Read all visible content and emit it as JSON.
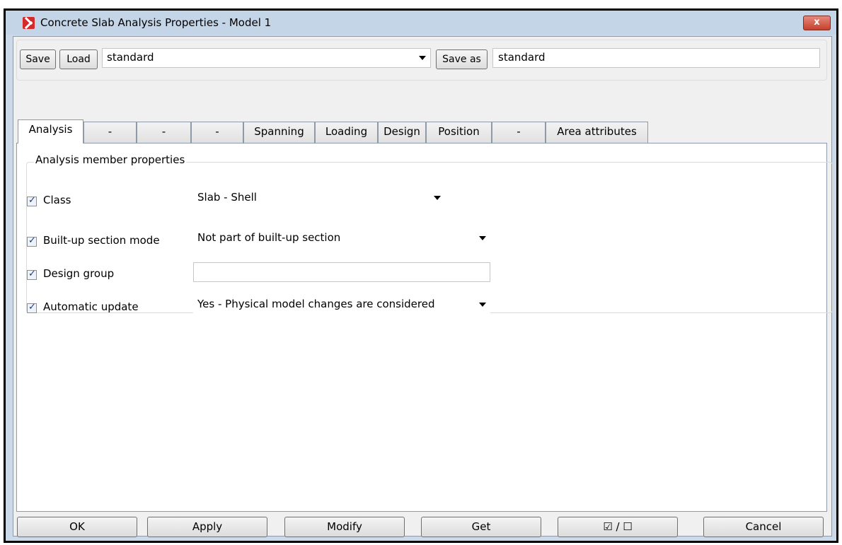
{
  "window": {
    "title": "Concrete Slab Analysis Properties - Model 1",
    "close_label": "x"
  },
  "toolbar": {
    "save_label": "Save",
    "load_label": "Load",
    "preset_value": "standard",
    "save_as_label": "Save as",
    "save_as_value": "standard"
  },
  "tabs": [
    {
      "label": "Analysis",
      "active": true
    },
    {
      "label": "-"
    },
    {
      "label": "-"
    },
    {
      "label": "-"
    },
    {
      "label": "Spanning"
    },
    {
      "label": "Loading"
    },
    {
      "label": "Design"
    },
    {
      "label": "Position"
    },
    {
      "label": "-"
    },
    {
      "label": "Area attributes"
    }
  ],
  "group": {
    "title": "Analysis member properties",
    "rows": [
      {
        "label": "Class",
        "value": "Slab - Shell",
        "checked": true
      },
      {
        "label": "Built-up section mode",
        "value": "Not part of built-up section",
        "checked": true
      },
      {
        "label": "Design group",
        "value": "",
        "checked": true
      },
      {
        "label": "Automatic update",
        "value": "Yes - Physical model changes are considered",
        "checked": true
      }
    ]
  },
  "footer": {
    "ok": "OK",
    "apply": "Apply",
    "modify": "Modify",
    "get": "Get",
    "toggle": "☑ / ☐",
    "cancel": "Cancel"
  }
}
